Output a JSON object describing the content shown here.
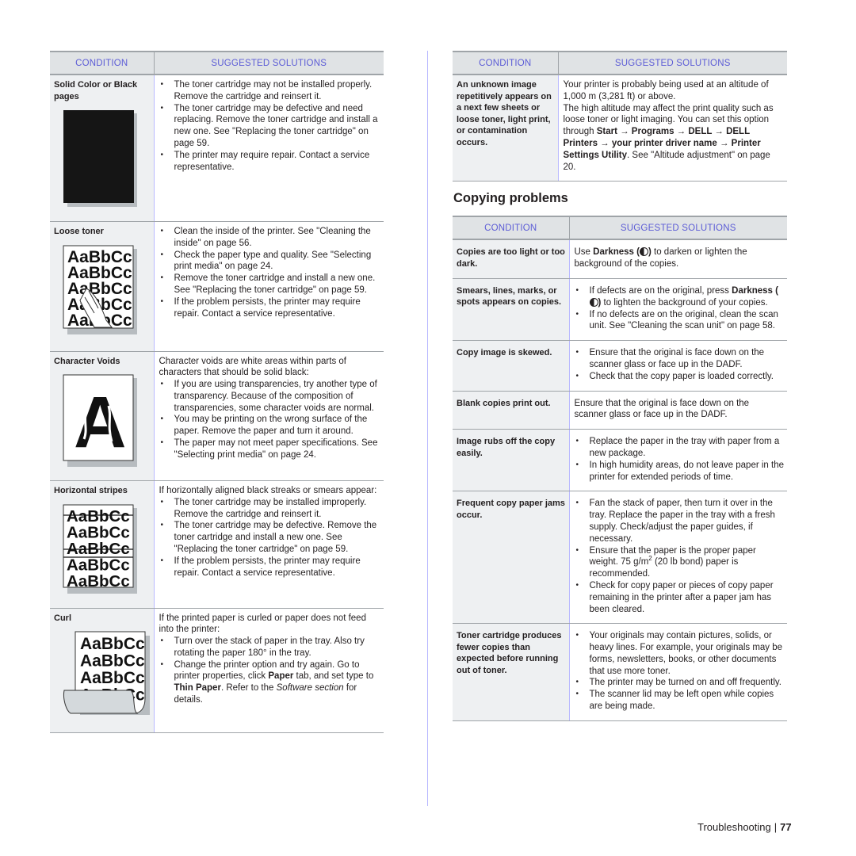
{
  "page": {
    "section_title": "Copying problems",
    "footer_label": "Troubleshooting",
    "footer_page": "77"
  },
  "headers": {
    "condition": "CONDITION",
    "solutions": "SUGGESTED SOLUTIONS"
  },
  "colors": {
    "header_text": "#5c5cd6",
    "header_bg": "#e0e3e5",
    "condition_bg": "#eef0f2",
    "divider": "#b8b8ff"
  },
  "print_quality_table": [
    {
      "condition": "Solid Color or Black pages",
      "illustration": "solid-black-page",
      "intro": "",
      "bullets": [
        "The toner cartridge may not be installed properly. Remove the cartridge and reinsert it.",
        "The toner cartridge may be defective and need replacing. Remove the toner cartridge and install a new one. See \"Replacing the toner cartridge\" on page 59.",
        "The printer may require repair. Contact a service representative."
      ]
    },
    {
      "condition": "Loose toner",
      "illustration": "loose-toner-sample",
      "intro": "",
      "bullets": [
        "Clean the inside of the printer. See \"Cleaning the inside\" on page 56.",
        "Check the paper type and quality. See \"Selecting print media\" on page 24.",
        "Remove the toner cartridge and install a new one. See \"Replacing the toner cartridge\" on page 59.",
        "If the problem persists, the printer may require repair. Contact a service representative."
      ]
    },
    {
      "condition": "Character Voids",
      "illustration": "character-void-sample",
      "intro": "Character voids are white areas within parts of characters that should be solid black:",
      "bullets": [
        "If you are using transparencies, try another type of transparency. Because of the composition of transparencies, some character voids are normal.",
        "You may be printing on the wrong surface of the paper. Remove the paper and turn it around.",
        "The paper may not meet paper specifications. See \"Selecting print media\" on page 24."
      ]
    },
    {
      "condition": "Horizontal stripes",
      "illustration": "horizontal-stripes-sample",
      "intro": "If horizontally aligned black streaks or smears appear:",
      "bullets": [
        "The toner cartridge may be installed improperly. Remove the cartridge and reinsert it.",
        "The toner cartridge may be defective. Remove the toner cartridge and install a new one. See \"Replacing the toner cartridge\" on page 59.",
        "If the problem persists, the printer may require repair. Contact a service representative."
      ]
    },
    {
      "condition": "Curl",
      "illustration": "curl-sample",
      "intro": "If the printed paper is curled or paper does not feed into the printer:",
      "bullets": [
        "Turn over the stack of paper in the tray. Also try rotating the paper 180° in the tray.",
        "Change the printer option and try again. Go to printer properties, click {b:Paper} tab, and set type to {b:Thin Paper}. Refer to the {i:Software section} for details."
      ]
    }
  ],
  "sample_text": "AaBbCc",
  "void_letter": "A",
  "altitude_table": [
    {
      "condition": "An unknown image repetitively appears on a next few sheets or loose toner, light print, or contamination occurs.",
      "paragraphs": [
        "Your printer is probably being used at an altitude of 1,000 m (3,281 ft) or above.",
        "The high altitude may affect the print quality such as loose toner or light imaging. You can set this option through {b:Start → Programs → DELL → DELL Printers → your printer driver name → Printer Settings Utility}. See \"Altitude adjustment\" on page 20."
      ]
    }
  ],
  "copying_table": [
    {
      "condition": "Copies are too light or too dark.",
      "paragraphs": [
        "Use {b:Darkness (}{icon:darkness}{b:)} to darken or lighten the background of the copies."
      ],
      "bullets": []
    },
    {
      "condition": "Smears, lines, marks, or spots appears on copies.",
      "paragraphs": [],
      "bullets": [
        "If defects are on the original, press {b:Darkness (}{icon:darkness}{b:)} to lighten the background of your copies.",
        "If no defects are on the original, clean the scan unit. See \"Cleaning the scan unit\" on page 58."
      ]
    },
    {
      "condition": "Copy image is skewed.",
      "paragraphs": [],
      "bullets": [
        "Ensure that the original is face down on the scanner glass or face up in the DADF.",
        "Check that the copy paper is loaded correctly."
      ]
    },
    {
      "condition": "Blank copies print out.",
      "paragraphs": [
        "Ensure that the original is face down on the scanner glass or face up in the DADF."
      ],
      "bullets": []
    },
    {
      "condition": "Image rubs off the copy easily.",
      "paragraphs": [],
      "bullets": [
        "Replace the paper in the tray with paper from a new package.",
        "In high humidity areas, do not leave paper in the printer for extended periods of time."
      ]
    },
    {
      "condition": "Frequent copy paper jams occur.",
      "paragraphs": [],
      "bullets": [
        "Fan the stack of paper, then turn it over in the tray. Replace the paper in the tray with a fresh supply. Check/adjust the paper guides, if necessary.",
        "Ensure that the paper is the proper paper weight. 75 g/m{sup:2} (20 lb bond) paper is recommended.",
        "Check for copy paper or pieces of copy paper remaining in the printer after a paper jam has been cleared."
      ]
    },
    {
      "condition": "Toner cartridge produces fewer copies than expected before running out of toner.",
      "paragraphs": [],
      "bullets": [
        "Your originals may contain pictures, solids, or heavy lines. For example, your originals may be forms, newsletters, books, or other documents that use more toner.",
        "The printer may be turned on and off frequently.",
        "The scanner lid may be left open while copies are being made."
      ]
    }
  ]
}
